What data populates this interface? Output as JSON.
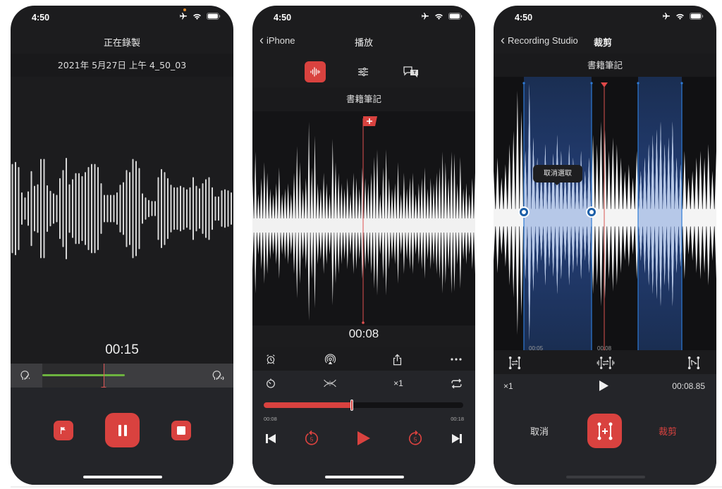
{
  "status_bar": {
    "time": "4:50",
    "icons": [
      "airplane-icon",
      "wifi-icon",
      "battery-icon"
    ]
  },
  "screens": [
    {
      "id": "recording",
      "nav_title": "正在錄製",
      "subtitle": "2021年 5月27日 上午 4_50_03",
      "elapsed": "00:15",
      "recording_level_fraction": 0.37,
      "controls": {
        "flag": "flag-icon",
        "pause": "pause-icon",
        "stop": "stop-icon"
      },
      "waveform_bars": [
        0.88,
        0.92,
        0.82,
        0.32,
        0.22,
        0.34,
        0.74,
        0.45,
        0.48,
        0.98,
        0.98,
        0.46,
        0.35,
        0.3,
        0.27,
        0.6,
        0.76,
        1.0,
        0.48,
        0.58,
        0.7,
        0.7,
        0.64,
        0.72,
        0.82,
        0.88,
        0.88,
        0.82,
        0.5,
        0.27,
        0.27,
        0.27,
        0.27,
        0.32,
        0.47,
        0.52,
        0.76,
        0.72,
        0.98,
        0.94,
        0.8,
        0.3,
        0.22,
        0.17,
        0.15,
        0.15,
        0.62,
        0.78,
        0.72,
        0.6,
        0.47,
        0.42,
        0.42,
        0.45,
        0.42,
        0.38,
        0.42,
        0.62,
        0.45,
        0.4,
        0.5,
        0.58,
        0.62,
        0.42,
        0.24,
        0.24,
        0.36,
        0.38,
        0.36,
        0.32
      ]
    },
    {
      "id": "playback",
      "back_label": "iPhone",
      "nav_title": "播放",
      "tabs": [
        {
          "icon": "waveform-icon",
          "active": true
        },
        {
          "icon": "equalizer-sliders-icon",
          "active": false
        },
        {
          "icon": "transcript-bubbles-icon",
          "active": false
        }
      ],
      "title": "書籍筆記",
      "current_time": "00:08",
      "toolbar1": [
        "alarm-icon",
        "airplay-icon",
        "share-icon",
        "more-icon"
      ],
      "toolbar2": {
        "timer": "timer-icon",
        "fx": "noise-reduction-icon",
        "speed": "×1",
        "repeat": "repeat-icon"
      },
      "progress": {
        "fraction": 0.44,
        "start_label": "00:08",
        "end_label": "00:18"
      },
      "transport": [
        "skip-back-icon",
        "rewind-5-icon",
        "play-icon",
        "forward-5-icon",
        "skip-forward-icon"
      ],
      "rewind_seconds": "5",
      "forward_seconds": "5",
      "waveform_peaks": [
        0.45,
        0.7,
        0.3,
        0.45,
        0.6,
        0.5,
        0.35,
        0.3,
        0.4,
        0.55,
        0.3,
        0.35,
        0.4,
        0.3,
        0.5,
        0.75,
        0.6,
        0.35,
        0.45,
        0.98,
        0.55,
        0.85,
        0.4,
        0.35,
        0.5,
        0.4,
        0.3,
        0.82,
        0.6,
        0.5,
        0.4,
        0.35,
        0.45,
        0.3,
        0.5,
        0.45,
        0.35,
        0.55,
        0.45,
        0.4,
        0.5,
        0.65,
        0.72,
        0.3,
        0.55,
        0.72,
        0.45,
        0.35,
        0.4,
        0.6,
        0.3,
        0.5,
        0.35,
        0.45,
        0.5,
        0.3,
        0.4,
        0.45,
        0.55,
        0.35,
        0.45,
        0.4,
        0.5,
        0.55,
        0.7,
        0.6,
        0.45,
        0.7,
        0.68,
        0.4,
        0.65,
        0.35,
        0.4,
        0.3,
        0.45,
        0.5
      ]
    },
    {
      "id": "trim",
      "back_label": "Recording Studio",
      "nav_title": "裁剪",
      "title": "書籍筆記",
      "tooltip": "取消選取",
      "time_labels": [
        "00:05",
        "00:08"
      ],
      "tools": [
        "trim-select-icon",
        "trim-silence-icon",
        "trim-to-end-icon"
      ],
      "speed": "×1",
      "duration": "00:08.85",
      "cancel_label": "取消",
      "crop_label": "裁剪",
      "add_selection_icon": "add-selection-icon",
      "waveform_peaks": [
        0.35,
        0.45,
        0.3,
        0.4,
        0.55,
        0.65,
        0.95,
        0.8,
        0.5,
        1.0,
        0.6,
        0.45,
        0.35,
        0.55,
        0.4,
        0.48,
        0.62,
        0.5,
        0.35,
        0.55,
        0.45,
        0.4,
        0.5,
        0.35,
        0.45,
        0.62,
        0.55,
        0.72,
        0.66,
        0.5,
        0.6,
        0.55,
        0.45,
        0.35,
        0.4,
        0.3,
        0.5,
        0.35,
        0.45,
        0.55,
        0.62,
        0.66,
        0.72,
        0.55,
        0.6,
        0.72,
        0.45,
        0.4,
        0.5,
        0.3,
        0.35,
        0.45,
        0.5,
        0.45,
        0.55,
        0.35,
        0.5
      ]
    }
  ]
}
